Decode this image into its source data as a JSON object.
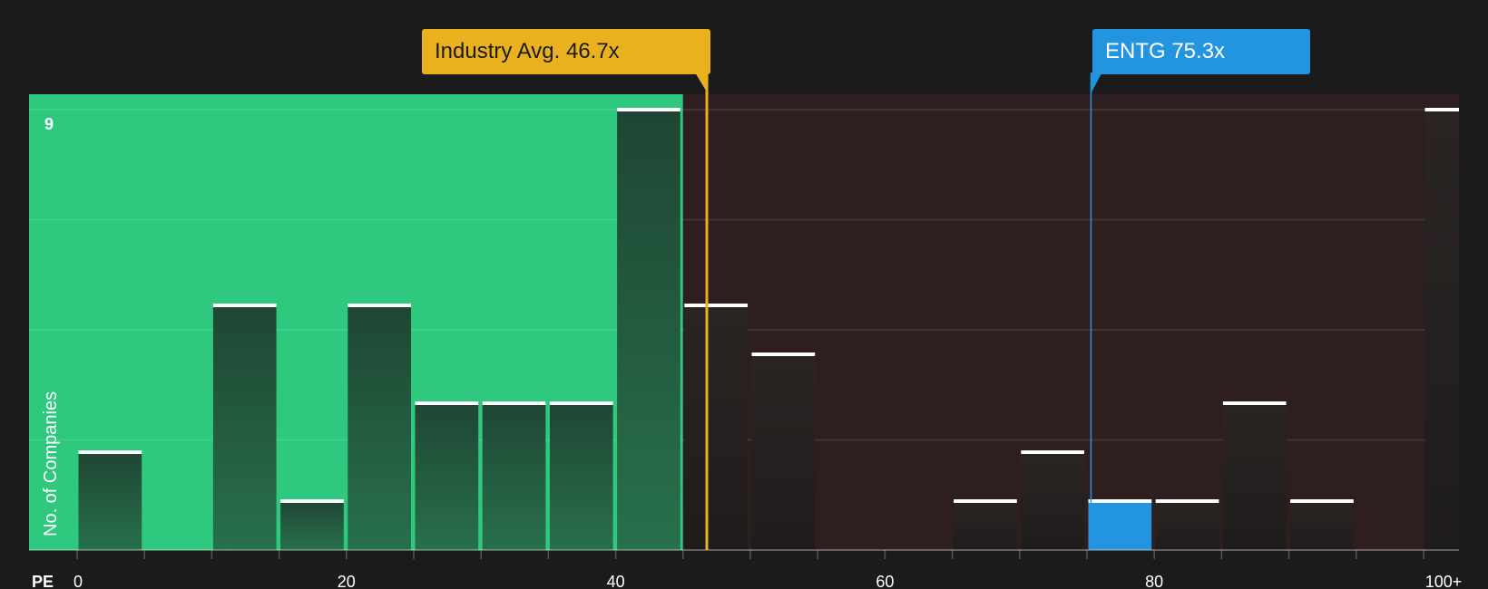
{
  "chart_data": {
    "type": "bar",
    "xlabel": "PE",
    "ylabel": "No. of Companies",
    "x_ticks": [
      "0",
      "20",
      "40",
      "60",
      "80",
      "100+"
    ],
    "y_ticks": [
      "9"
    ],
    "xlim": [
      0,
      100
    ],
    "ylim": [
      0,
      9
    ],
    "bin_width": 5,
    "grid": true,
    "bins": [
      {
        "x0": 0,
        "x1": 5,
        "value": 2
      },
      {
        "x0": 5,
        "x1": 10,
        "value": 0
      },
      {
        "x0": 10,
        "x1": 15,
        "value": 5
      },
      {
        "x0": 15,
        "x1": 20,
        "value": 1
      },
      {
        "x0": 20,
        "x1": 25,
        "value": 5
      },
      {
        "x0": 25,
        "x1": 30,
        "value": 3
      },
      {
        "x0": 30,
        "x1": 35,
        "value": 3
      },
      {
        "x0": 35,
        "x1": 40,
        "value": 3
      },
      {
        "x0": 40,
        "x1": 45,
        "value": 9
      },
      {
        "x0": 45,
        "x1": 50,
        "value": 5
      },
      {
        "x0": 50,
        "x1": 55,
        "value": 4
      },
      {
        "x0": 55,
        "x1": 60,
        "value": 0
      },
      {
        "x0": 60,
        "x1": 65,
        "value": 0
      },
      {
        "x0": 65,
        "x1": 70,
        "value": 1
      },
      {
        "x0": 70,
        "x1": 75,
        "value": 2
      },
      {
        "x0": 75,
        "x1": 80,
        "value": 1,
        "highlight": true
      },
      {
        "x0": 80,
        "x1": 85,
        "value": 1
      },
      {
        "x0": 85,
        "x1": 90,
        "value": 3
      },
      {
        "x0": 90,
        "x1": 95,
        "value": 1
      },
      {
        "x0": 95,
        "x1": 100,
        "value": 0
      },
      {
        "x0": 100,
        "x1": 105,
        "value": 9
      }
    ],
    "undervalued_max": 45,
    "annotations": [
      {
        "id": "industry",
        "label": "Industry Avg. 46.7x",
        "value": 46.7
      },
      {
        "id": "entg",
        "label": "ENTG 75.3x",
        "value": 75.3
      }
    ]
  },
  "colors": {
    "background": "#1b1b1b",
    "green_zone": "#2ec97f",
    "red_zone": "#2f1e1f",
    "bar_green": "#1f4a37",
    "bar_dark": "#2b2625",
    "bar_highlight": "#2394e0",
    "cap": "#ffffff",
    "industry": "#eab11e",
    "entg": "#2394e0"
  }
}
